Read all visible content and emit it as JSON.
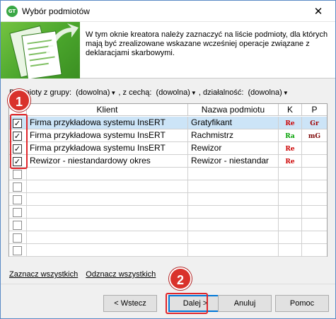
{
  "window": {
    "title": "Wybór podmiotów",
    "app_icon_text": "GT",
    "close_glyph": "✕"
  },
  "banner": {
    "text": "W tym oknie kreatora należy zaznaczyć na liście podmioty, dla których mają być zrealizowane wskazane wcześniej operacje związane z deklaracjami skarbowymi."
  },
  "filters": {
    "group_label": "Podmioty z grupy:",
    "group_value": "(dowolna)",
    "feature_label": ", z cechą:",
    "feature_value": "(dowolna)",
    "activity_label": ", działalność:",
    "activity_value": "(dowolna)"
  },
  "grid": {
    "columns": [
      "",
      "Klient",
      "Nazwa podmiotu",
      "K",
      "P"
    ],
    "rows": [
      {
        "checked": true,
        "client": "Firma przykładowa systemu InsERT",
        "name": "Gratyfikant",
        "k": "Re",
        "p": "Gr",
        "selected": true
      },
      {
        "checked": true,
        "client": "Firma przykładowa systemu InsERT",
        "name": "Rachmistrz",
        "k": "Ra",
        "p": "mG",
        "selected": false
      },
      {
        "checked": true,
        "client": "Firma przykładowa systemu InsERT",
        "name": "Rewizor",
        "k": "Re",
        "p": "",
        "selected": false
      },
      {
        "checked": true,
        "client": "Rewizor - niestandardowy okres",
        "name": "Rewizor - niestandar",
        "k": "Re",
        "p": "",
        "selected": false
      },
      {
        "checked": false,
        "client": "",
        "name": "",
        "k": "",
        "p": "",
        "selected": false
      },
      {
        "checked": false,
        "client": "",
        "name": "",
        "k": "",
        "p": "",
        "selected": false
      },
      {
        "checked": false,
        "client": "",
        "name": "",
        "k": "",
        "p": "",
        "selected": false
      },
      {
        "checked": false,
        "client": "",
        "name": "",
        "k": "",
        "p": "",
        "selected": false
      },
      {
        "checked": false,
        "client": "",
        "name": "",
        "k": "",
        "p": "",
        "selected": false
      },
      {
        "checked": false,
        "client": "",
        "name": "",
        "k": "",
        "p": "",
        "selected": false
      },
      {
        "checked": false,
        "client": "",
        "name": "",
        "k": "",
        "p": "",
        "selected": false
      }
    ]
  },
  "links": {
    "select_all": "Zaznacz wszystkich",
    "deselect_all": "Odznacz wszystkich"
  },
  "buttons": {
    "back": "< Wstecz",
    "next": "Dalej >",
    "cancel": "Anuluj",
    "help": "Pomoc"
  },
  "callouts": {
    "one": "1",
    "two": "2"
  },
  "colors": {
    "accent": "#0078d7",
    "callout": "#d9322b",
    "banner_green": "#4aa52c",
    "selected_row": "#cce4f7"
  }
}
